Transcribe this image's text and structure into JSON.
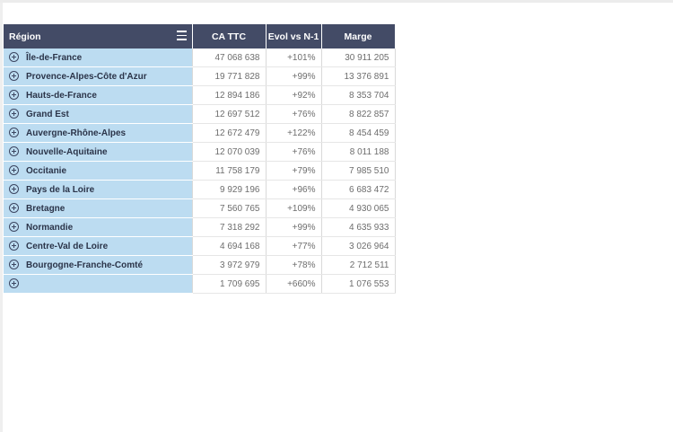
{
  "table": {
    "headers": {
      "region": "Région",
      "ca_ttc": "CA TTC",
      "evol": "Evol vs N-1",
      "marge": "Marge"
    },
    "menu_icon": "hamburger-menu-icon",
    "expand_icon": "plus-circle-icon",
    "rows": [
      {
        "region": "Île-de-France",
        "ca_ttc": "47 068 638",
        "evol": "+101%",
        "marge": "30 911 205"
      },
      {
        "region": "Provence-Alpes-Côte d'Azur",
        "ca_ttc": "19 771 828",
        "evol": "+99%",
        "marge": "13 376 891"
      },
      {
        "region": "Hauts-de-France",
        "ca_ttc": "12 894 186",
        "evol": "+92%",
        "marge": "8 353 704"
      },
      {
        "region": "Grand Est",
        "ca_ttc": "12 697 512",
        "evol": "+76%",
        "marge": "8 822 857"
      },
      {
        "region": "Auvergne-Rhône-Alpes",
        "ca_ttc": "12 672 479",
        "evol": "+122%",
        "marge": "8 454 459"
      },
      {
        "region": "Nouvelle-Aquitaine",
        "ca_ttc": "12 070 039",
        "evol": "+76%",
        "marge": "8 011 188"
      },
      {
        "region": "Occitanie",
        "ca_ttc": "11 758 179",
        "evol": "+79%",
        "marge": "7 985 510"
      },
      {
        "region": "Pays de la Loire",
        "ca_ttc": "9 929 196",
        "evol": "+96%",
        "marge": "6 683 472"
      },
      {
        "region": "Bretagne",
        "ca_ttc": "7 560 765",
        "evol": "+109%",
        "marge": "4 930 065"
      },
      {
        "region": "Normandie",
        "ca_ttc": "7 318 292",
        "evol": "+99%",
        "marge": "4 635 933"
      },
      {
        "region": "Centre-Val de Loire",
        "ca_ttc": "4 694 168",
        "evol": "+77%",
        "marge": "3 026 964"
      },
      {
        "region": "Bourgogne-Franche-Comté",
        "ca_ttc": "3 972 979",
        "evol": "+78%",
        "marge": "2 712 511"
      },
      {
        "region": "",
        "ca_ttc": "1 709 695",
        "evol": "+660%",
        "marge": "1 076 553"
      }
    ]
  },
  "colors": {
    "header_bg": "#434b66",
    "region_bg": "#bcdcf1",
    "region_text": "#2b3449"
  }
}
